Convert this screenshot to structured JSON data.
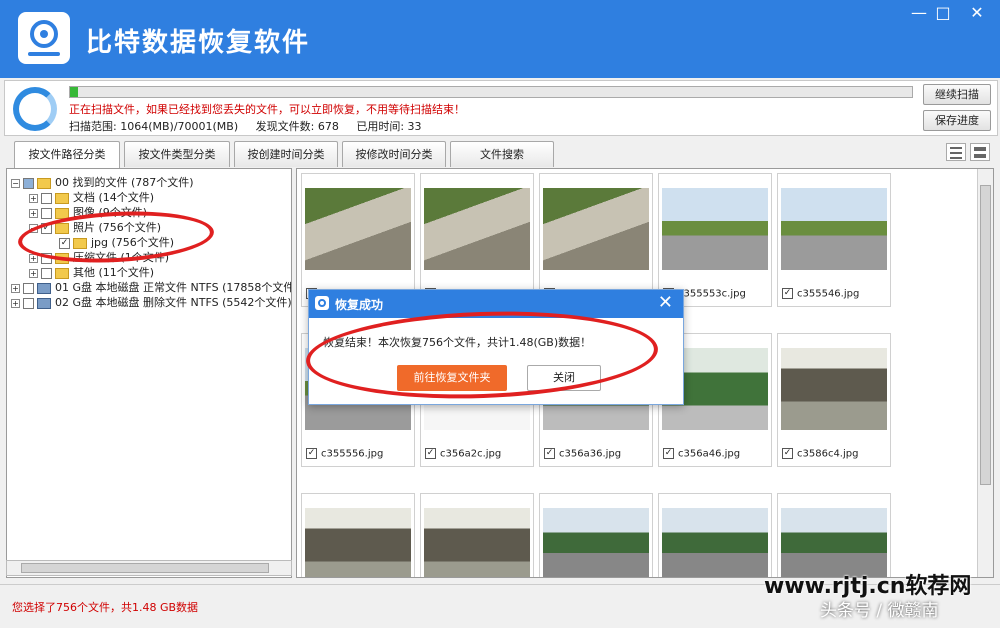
{
  "app": {
    "title": "比特数据恢复软件",
    "window_controls": [
      "minimize",
      "maximize",
      "close"
    ]
  },
  "scan": {
    "progress_fraction": 0.01,
    "warning": "正在扫描文件，如果已经找到您丢失的文件，可以立即恢复，不用等待扫描结束！",
    "range_label": "扫描范围: 1064(MB)/70001(MB)",
    "found_label": "发现文件数: 678",
    "elapsed_label": "已用时间: 33",
    "continue_button": "继续扫描",
    "save_button": "保存进度"
  },
  "tabs": [
    {
      "label": "按文件路径分类",
      "active": true
    },
    {
      "label": "按文件类型分类",
      "active": false
    },
    {
      "label": "按创建时间分类",
      "active": false
    },
    {
      "label": "按修改时间分类",
      "active": false
    },
    {
      "label": "文件搜索",
      "active": false
    }
  ],
  "tree": [
    {
      "label": "00 找到的文件  (787个文件)",
      "expander": "−",
      "check": "half",
      "icon": "folder"
    },
    {
      "label": "文档    (14个文件)",
      "expander": "+",
      "check": "",
      "icon": "folder"
    },
    {
      "label": "图像    (9个文件)",
      "expander": "+",
      "check": "",
      "icon": "folder"
    },
    {
      "label": "照片    (756个文件)",
      "expander": "−",
      "check": "✓",
      "icon": "folder"
    },
    {
      "label": "jpg    (756个文件)",
      "expander": "",
      "check": "✓",
      "icon": "folder"
    },
    {
      "label": "压缩文件    (1个文件)",
      "expander": "+",
      "check": "",
      "icon": "folder"
    },
    {
      "label": "其他    (11个文件)",
      "expander": "+",
      "check": "",
      "icon": "folder"
    },
    {
      "label": "01 G盘 本地磁盘 正常文件 NTFS  (17858个文件)",
      "expander": "+",
      "check": "",
      "icon": "disk"
    },
    {
      "label": "02 G盘 本地磁盘 删除文件 NTFS  (5542个文件)",
      "expander": "+",
      "check": "",
      "icon": "disk"
    }
  ],
  "thumbnails": [
    {
      "name": "",
      "image": "river-stones-people-icon"
    },
    {
      "name": "",
      "image": "river-stones-people-icon"
    },
    {
      "name": "",
      "image": "river-stones-people-icon"
    },
    {
      "name": "c355553c.jpg",
      "image": "park-road-icon"
    },
    {
      "name": "c355546.jpg",
      "image": "park-road-icon"
    },
    {
      "name": "c355556.jpg",
      "image": "park-road-icon"
    },
    {
      "name": "c356a2c.jpg",
      "image": "blank-image-icon"
    },
    {
      "name": "c356a36.jpg",
      "image": "crowd-trees-icon"
    },
    {
      "name": "c356a46.jpg",
      "image": "crowd-trees-icon"
    },
    {
      "name": "c3586c4.jpg",
      "image": "gate-person-icon"
    },
    {
      "name": "",
      "image": "gate-person-icon"
    },
    {
      "name": "",
      "image": "gate-person-icon"
    },
    {
      "name": "",
      "image": "plaza-people-icon"
    },
    {
      "name": "",
      "image": "plaza-people-icon"
    },
    {
      "name": "",
      "image": "plaza-people-icon"
    }
  ],
  "dialog": {
    "title": "恢复成功",
    "message": "恢复结束！本次恢复756个文件，共计1.48(GB)数据！",
    "open_folder_button": "前往恢复文件夹",
    "close_button": "关闭"
  },
  "status": {
    "text": "您选择了756个文件，共1.48 GB数据"
  },
  "watermark": {
    "line1": "www.rjtj.cn软荐网",
    "line2": "头条号 / 微赣南"
  },
  "colors": {
    "titlebar": "#2f7fe0",
    "warning": "#d00000",
    "accent_button": "#f06a2a",
    "annotation": "#e02020"
  }
}
